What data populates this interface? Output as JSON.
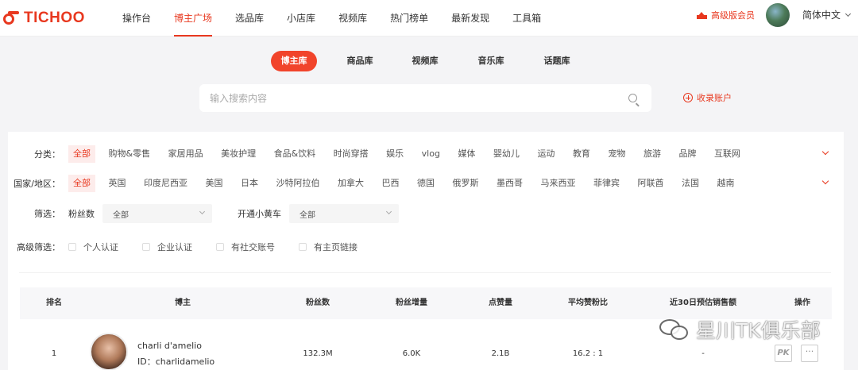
{
  "brand": {
    "logo_text": "TICHOO"
  },
  "nav": {
    "items": [
      "操作台",
      "博主广场",
      "选品库",
      "小店库",
      "视频库",
      "热门榜单",
      "最新发现",
      "工具箱"
    ],
    "active_index": 1
  },
  "header": {
    "vip_label": "高级版会员",
    "language": "简体中文"
  },
  "subtabs": {
    "items": [
      "博主库",
      "商品库",
      "视频库",
      "音乐库",
      "话题库"
    ],
    "active_index": 0
  },
  "search": {
    "placeholder": "输入搜索内容",
    "collect_label": "收录账户"
  },
  "filters": {
    "category": {
      "label": "分类：",
      "options": [
        "全部",
        "购物&零售",
        "家居用品",
        "美妆护理",
        "食品&饮料",
        "时尚穿搭",
        "娱乐",
        "vlog",
        "媒体",
        "婴幼儿",
        "运动",
        "教育",
        "宠物",
        "旅游",
        "品牌",
        "互联网"
      ],
      "selected": "全部"
    },
    "region": {
      "label": "国家/地区：",
      "options": [
        "全部",
        "英国",
        "印度尼西亚",
        "美国",
        "日本",
        "沙特阿拉伯",
        "加拿大",
        "巴西",
        "德国",
        "俄罗斯",
        "墨西哥",
        "马来西亚",
        "菲律宾",
        "阿联酋",
        "法国",
        "越南"
      ],
      "selected": "全部"
    },
    "screen": {
      "label": "筛选：",
      "fans_label": "粉丝数",
      "fans_value": "全部",
      "cart_label": "开通小黄车",
      "cart_value": "全部"
    },
    "advanced": {
      "label": "高级筛选：",
      "checkboxes": [
        "个人认证",
        "企业认证",
        "有社交账号",
        "有主页链接"
      ]
    }
  },
  "table": {
    "columns": [
      "排名",
      "博主",
      "粉丝数",
      "粉丝增量",
      "点赞量",
      "平均赞粉比",
      "近30日预估销售额",
      "操作"
    ],
    "rows": [
      {
        "rank": "1",
        "name": "charli d'amelio",
        "id": "ID：charlidamelio",
        "fans": "132.3M",
        "fans_growth": "6.0K",
        "likes": "2.1B",
        "like_fan_ratio": "16.2 : 1",
        "sales_30d": "-",
        "pk_label": "PK",
        "more_label": "···"
      }
    ]
  },
  "watermark": {
    "text": "星川TK俱乐部"
  },
  "colors": {
    "accent": "#e8381f",
    "chip_active_bg": "#fdeceb"
  }
}
